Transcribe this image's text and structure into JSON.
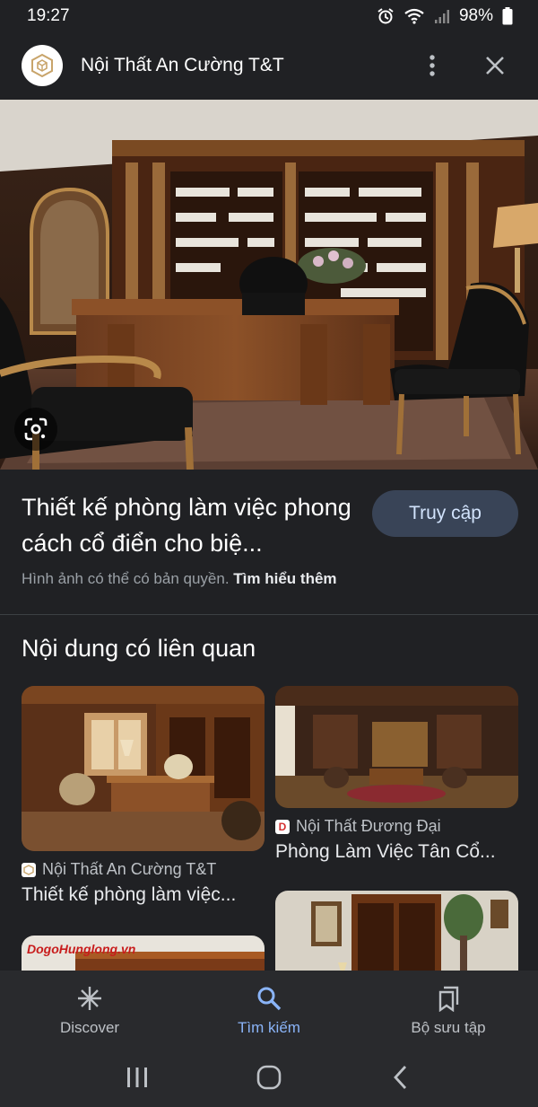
{
  "status_bar": {
    "time": "19:27",
    "battery": "98%"
  },
  "header": {
    "site_name": "Nội Thất An Cường T&T"
  },
  "main": {
    "image_title": "Thiết kế phòng làm việc phong cách cổ điển cho biệ...",
    "visit_label": "Truy cập",
    "copyright_text": "Hình ảnh có thể có bản quyền.",
    "learn_more": "Tìm hiểu thêm"
  },
  "related": {
    "heading": "Nội dung có liên quan",
    "cards": [
      {
        "source": "Nội Thất An Cường T&T",
        "title": "Thiết kế phòng làm việc..."
      },
      {
        "source": "Nội Thất Đương Đại",
        "source_icon_letter": "D",
        "title": "Phòng Làm Việc Tân Cổ..."
      },
      {
        "watermark": "DogoHunglong.vn"
      },
      {}
    ]
  },
  "bottom_nav": [
    {
      "label": "Discover",
      "icon": "asterisk-icon"
    },
    {
      "label": "Tìm kiếm",
      "icon": "search-icon",
      "active": true
    },
    {
      "label": "Bộ sưu tập",
      "icon": "collections-icon"
    }
  ],
  "colors": {
    "accent": "#8ab4f8",
    "background": "#202124",
    "visit_button": "#394457"
  }
}
